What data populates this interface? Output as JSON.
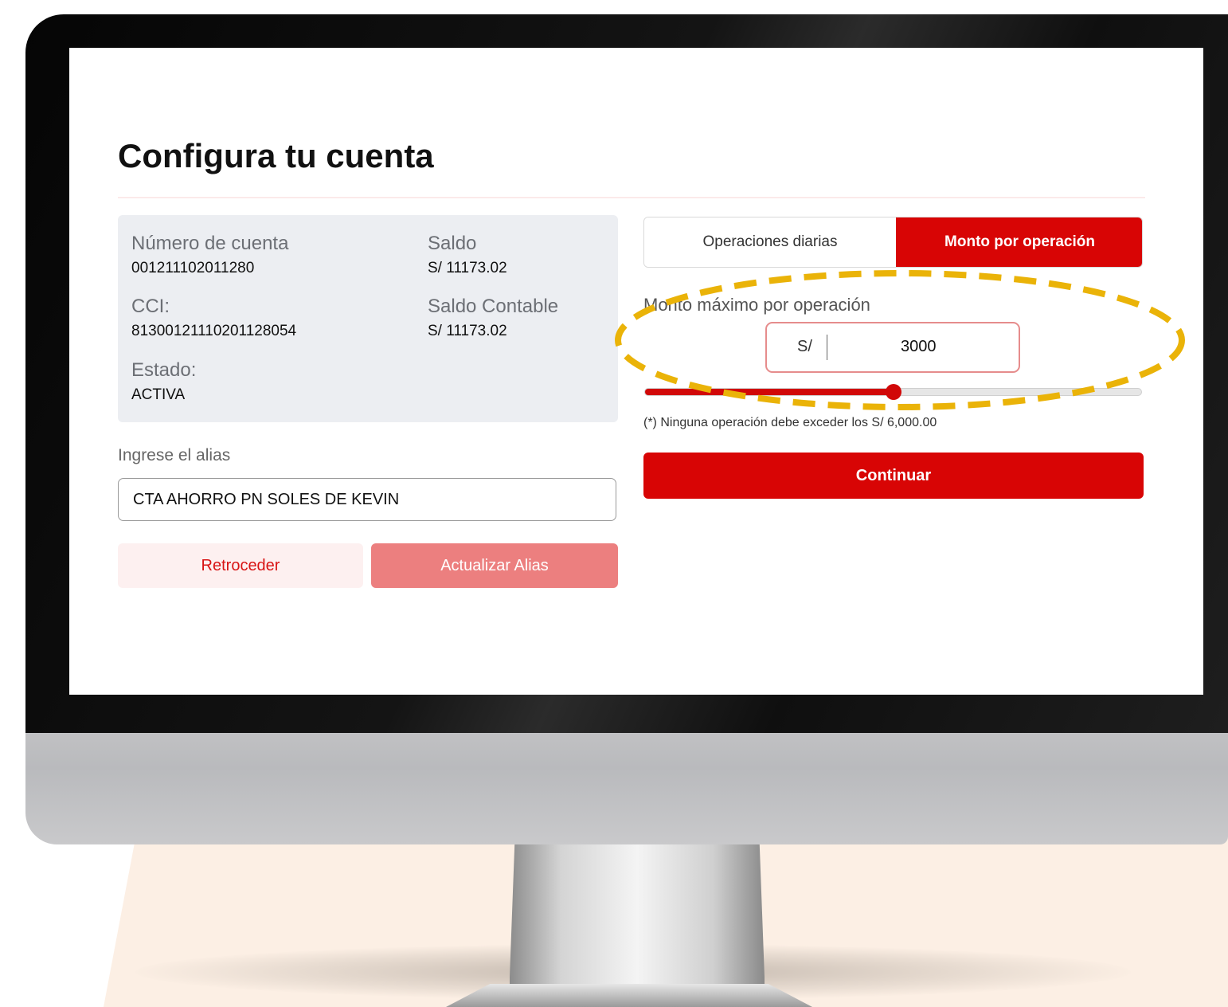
{
  "page_title": "Configura tu cuenta",
  "account": {
    "number_label": "Número de cuenta",
    "number_value": "001211102011280",
    "balance_label": "Saldo",
    "balance_value": "S/ 11173.02",
    "cci_label": "CCI:",
    "cci_value": "81300121110201128054",
    "accounting_balance_label": "Saldo Contable",
    "accounting_balance_value": "S/ 11173.02",
    "status_label": "Estado:",
    "status_value": "ACTIVA"
  },
  "alias": {
    "label": "Ingrese el alias",
    "value": "CTA AHORRO PN SOLES DE KEVIN"
  },
  "buttons": {
    "back": "Retroceder",
    "update_alias": "Actualizar Alias",
    "continue": "Continuar"
  },
  "tabs": [
    {
      "label": "Operaciones diarias",
      "active": false
    },
    {
      "label": "Monto por operación",
      "active": true
    }
  ],
  "limit": {
    "label": "Monto máximo por operación",
    "currency": "S/",
    "amount": "3000",
    "slider_fraction": 0.5,
    "note": "(*) Ninguna operación debe exceder los S/ 6,000.00"
  },
  "colors": {
    "brand_red": "#d80505",
    "disabled_red": "#ec7f7f",
    "highlight": "#eab308"
  }
}
